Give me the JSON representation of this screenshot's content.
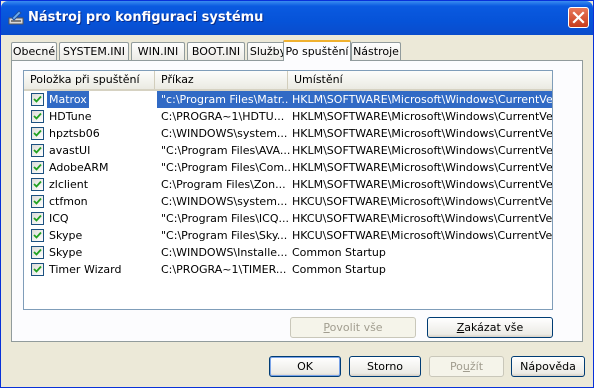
{
  "window": {
    "title": "Nástroj pro konfiguraci systému",
    "close_label": "×"
  },
  "tabs": [
    {
      "label": "Obecné"
    },
    {
      "label": "SYSTEM.INI"
    },
    {
      "label": "WIN.INI"
    },
    {
      "label": "BOOT.INI"
    },
    {
      "label": "Služby"
    },
    {
      "label": "Po spuštění",
      "active": true
    },
    {
      "label": "Nástroje"
    }
  ],
  "list": {
    "columns": [
      "Položka při spuštění",
      "Příkaz",
      "Umístění"
    ],
    "rows": [
      {
        "item": "Matrox",
        "command": "\"c:\\Program Files\\Matr...",
        "location": "HKLM\\SOFTWARE\\Microsoft\\Windows\\CurrentVer...",
        "checked": true,
        "selected": true
      },
      {
        "item": "HDTune",
        "command": "C:\\PROGRA~1\\HDTU...",
        "location": "HKLM\\SOFTWARE\\Microsoft\\Windows\\CurrentVer...",
        "checked": true
      },
      {
        "item": "hpztsb06",
        "command": "C:\\WINDOWS\\system...",
        "location": "HKLM\\SOFTWARE\\Microsoft\\Windows\\CurrentVer...",
        "checked": true
      },
      {
        "item": "avastUI",
        "command": "\"C:\\Program Files\\AVA...",
        "location": "HKLM\\SOFTWARE\\Microsoft\\Windows\\CurrentVer...",
        "checked": true
      },
      {
        "item": "AdobeARM",
        "command": "\"C:\\Program Files\\Com...",
        "location": "HKLM\\SOFTWARE\\Microsoft\\Windows\\CurrentVer...",
        "checked": true
      },
      {
        "item": "zlclient",
        "command": "C:\\Program Files\\Zon...",
        "location": "HKLM\\SOFTWARE\\Microsoft\\Windows\\CurrentVer...",
        "checked": true
      },
      {
        "item": "ctfmon",
        "command": "C:\\WINDOWS\\system...",
        "location": "HKCU\\SOFTWARE\\Microsoft\\Windows\\CurrentVer...",
        "checked": true
      },
      {
        "item": "ICQ",
        "command": "\"C:\\Program Files\\ICQ...",
        "location": "HKCU\\SOFTWARE\\Microsoft\\Windows\\CurrentVer...",
        "checked": true
      },
      {
        "item": "Skype",
        "command": "\"C:\\Program Files\\Sky...",
        "location": "HKCU\\SOFTWARE\\Microsoft\\Windows\\CurrentVer...",
        "checked": true
      },
      {
        "item": "Skype",
        "command": "C:\\WINDOWS\\Installe...",
        "location": "Common Startup",
        "checked": true
      },
      {
        "item": "Timer Wizard",
        "command": "C:\\PROGRA~1\\TIMER...",
        "location": "Common Startup",
        "checked": true
      }
    ]
  },
  "panel_buttons": {
    "enable_all": {
      "accel": "P",
      "rest": "ovolit vše",
      "disabled": true
    },
    "disable_all": {
      "accel": "Z",
      "rest": "akázat vše"
    }
  },
  "dialog_buttons": {
    "ok": "OK",
    "cancel": "Storno",
    "apply": {
      "accel": "u",
      "pre": "Po",
      "post": "žít",
      "disabled": true
    },
    "help": "Nápověda"
  },
  "colors": {
    "selection": "#316ac5",
    "titlebar": "#0653d8",
    "active_tab": "#f0b12f"
  }
}
